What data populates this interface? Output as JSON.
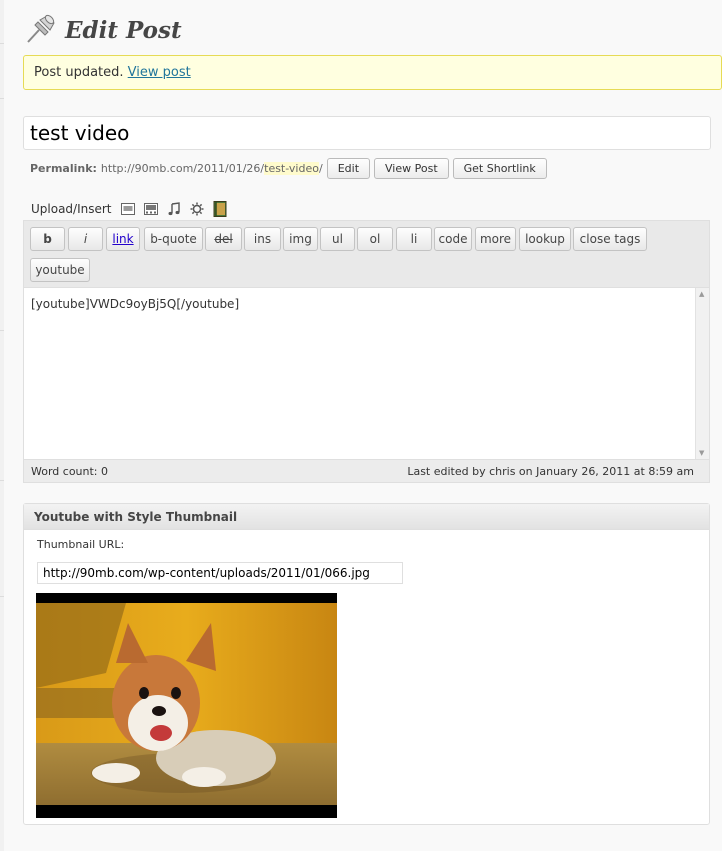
{
  "page": {
    "title": "Edit Post"
  },
  "notice": {
    "text": "Post updated.",
    "link": "View post"
  },
  "post": {
    "title": "test video"
  },
  "permalink": {
    "label": "Permalink:",
    "url_prefix": "http://90mb.com/2011/01/26/",
    "slug": "test-video",
    "url_suffix": "/",
    "buttons": {
      "edit": "Edit",
      "view": "View Post",
      "shortlink": "Get Shortlink"
    }
  },
  "upload": {
    "label": "Upload/Insert",
    "icons": [
      "image-icon",
      "video-icon",
      "audio-icon",
      "media-icon",
      "book-icon"
    ]
  },
  "toolbar": {
    "buttons": [
      {
        "label": "b",
        "name": "bold"
      },
      {
        "label": "i",
        "name": "italic"
      },
      {
        "label": "link",
        "name": "link"
      },
      {
        "label": "b-quote",
        "name": "blockquote"
      },
      {
        "label": "del",
        "name": "del"
      },
      {
        "label": "ins",
        "name": "ins"
      },
      {
        "label": "img",
        "name": "img"
      },
      {
        "label": "ul",
        "name": "ul"
      },
      {
        "label": "ol",
        "name": "ol"
      },
      {
        "label": "li",
        "name": "li"
      },
      {
        "label": "code",
        "name": "code"
      },
      {
        "label": "more",
        "name": "more"
      },
      {
        "label": "lookup",
        "name": "lookup"
      },
      {
        "label": "close tags",
        "name": "close-tags"
      },
      {
        "label": "youtube",
        "name": "youtube"
      }
    ]
  },
  "editor": {
    "content": "[youtube]VWDc9oyBj5Q[/youtube]"
  },
  "status": {
    "word_count": "Word count: 0",
    "last_edited": "Last edited by chris on January 26, 2011 at 8:59 am"
  },
  "youtube_box": {
    "title": "Youtube with Style Thumbnail",
    "label": "Thumbnail URL:",
    "url": "http://90mb.com/wp-content/uploads/2011/01/066.jpg"
  },
  "colors": {
    "link": "#21759b",
    "notice_bg": "#ffffe0",
    "notice_border": "#e6db55",
    "slug_highlight": "#fffbcc"
  }
}
